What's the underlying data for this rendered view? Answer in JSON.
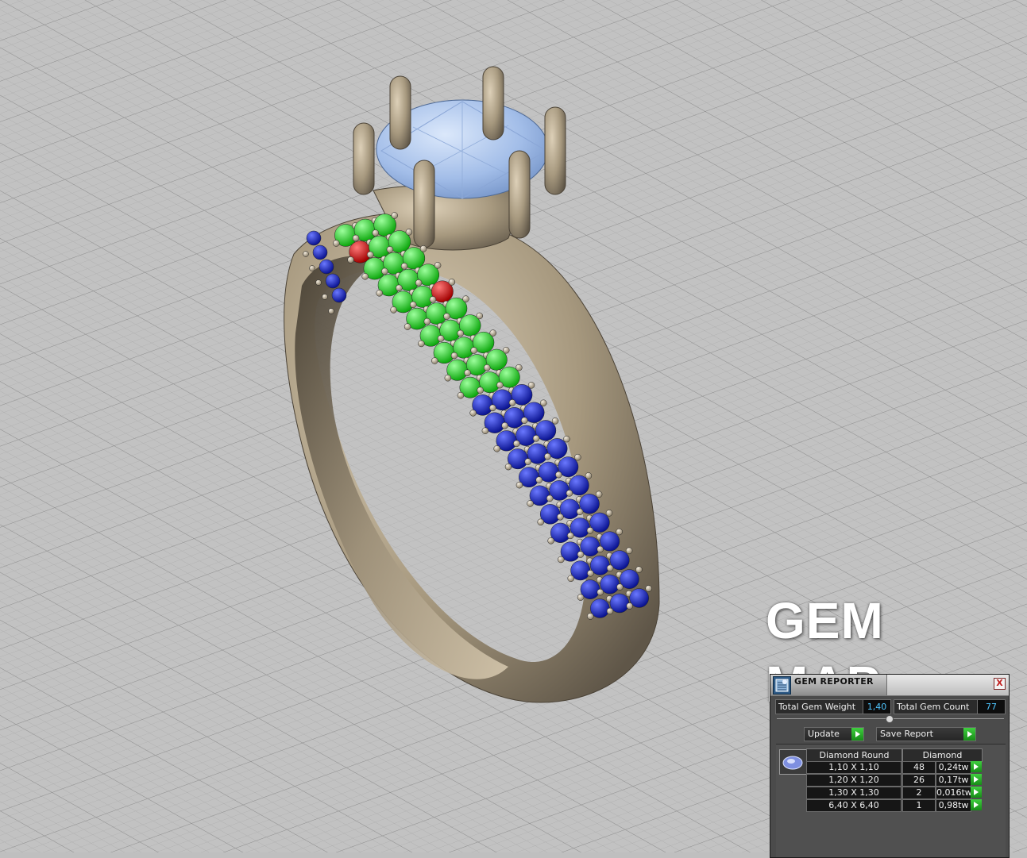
{
  "overlay_title": "GEM MAP",
  "reporter": {
    "title": "GEM REPORTER",
    "close_label": "X",
    "total_weight_label": "Total Gem Weight",
    "total_weight_value": "1,40",
    "total_count_label": "Total Gem Count",
    "total_count_value": "77",
    "update_label": "Update",
    "save_label": "Save Report",
    "table": {
      "col_shape": "Diamond Round",
      "col_material": "Diamond",
      "rows": [
        {
          "size": "1,10 X 1,10",
          "count": "48",
          "weight": "0,24tw"
        },
        {
          "size": "1,20 X 1,20",
          "count": "26",
          "weight": "0,17tw"
        },
        {
          "size": "1,30 X 1,30",
          "count": "2",
          "weight": "0,016tw"
        },
        {
          "size": "6,40 X 6,40",
          "count": "1",
          "weight": "0,98tw"
        }
      ]
    }
  },
  "colors": {
    "viewport_bg": "#bfbfbf",
    "metal": "#b9ab92",
    "center_stone": "#a9c4ee",
    "gem_green": "#22dd22",
    "gem_blue": "#1424d2",
    "gem_red": "#dd1111",
    "accent_value": "#4fc6ff"
  }
}
